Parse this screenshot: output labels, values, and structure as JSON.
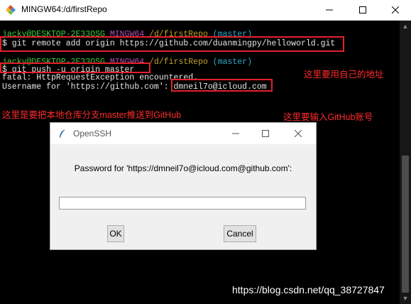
{
  "window": {
    "title": "MINGW64:/d/firstRepo",
    "icon": "mingw-diamond-icon"
  },
  "terminal": {
    "prompt1": {
      "user": "jacky@DESKTOP-2E33OSG",
      "env": "MINGW64",
      "path": "/d/firstRepo",
      "branch": "(master)"
    },
    "cmd1": "$ git remote add origin https://github.com/duanmingpy/helloworld.git",
    "prompt2": {
      "user": "jacky@DESKTOP-2E33OSG",
      "env": "MINGW64",
      "path": "/d/firstRepo",
      "branch": "(master)"
    },
    "cmd2": "$ git push -u origin master",
    "out1": "fatal: HttpRequestException encountered.",
    "out2_prefix": "Username for 'https://github.com': ",
    "out2_username": "dmneil7o@icloud.com"
  },
  "annotations": {
    "own_address": "这里要用自己的地址",
    "push_note": "这里是要把本地仓库分支master推送到GitHub",
    "account_note": "这里要输入GitHub账号"
  },
  "dialog": {
    "title": "OpenSSH",
    "prompt": "Password for 'https://dmneil7o@icloud.com@github.com':",
    "password_value": "",
    "ok_label": "OK",
    "cancel_label": "Cancel"
  },
  "watermark": "https://blog.csdn.net/qq_38727847",
  "colors": {
    "annotation_red": "#e4202b",
    "prompt_green": "#3ccb3c",
    "prompt_purple": "#b04fb0",
    "path_yellow": "#c0a02a",
    "branch_cyan": "#2aa9c9"
  }
}
